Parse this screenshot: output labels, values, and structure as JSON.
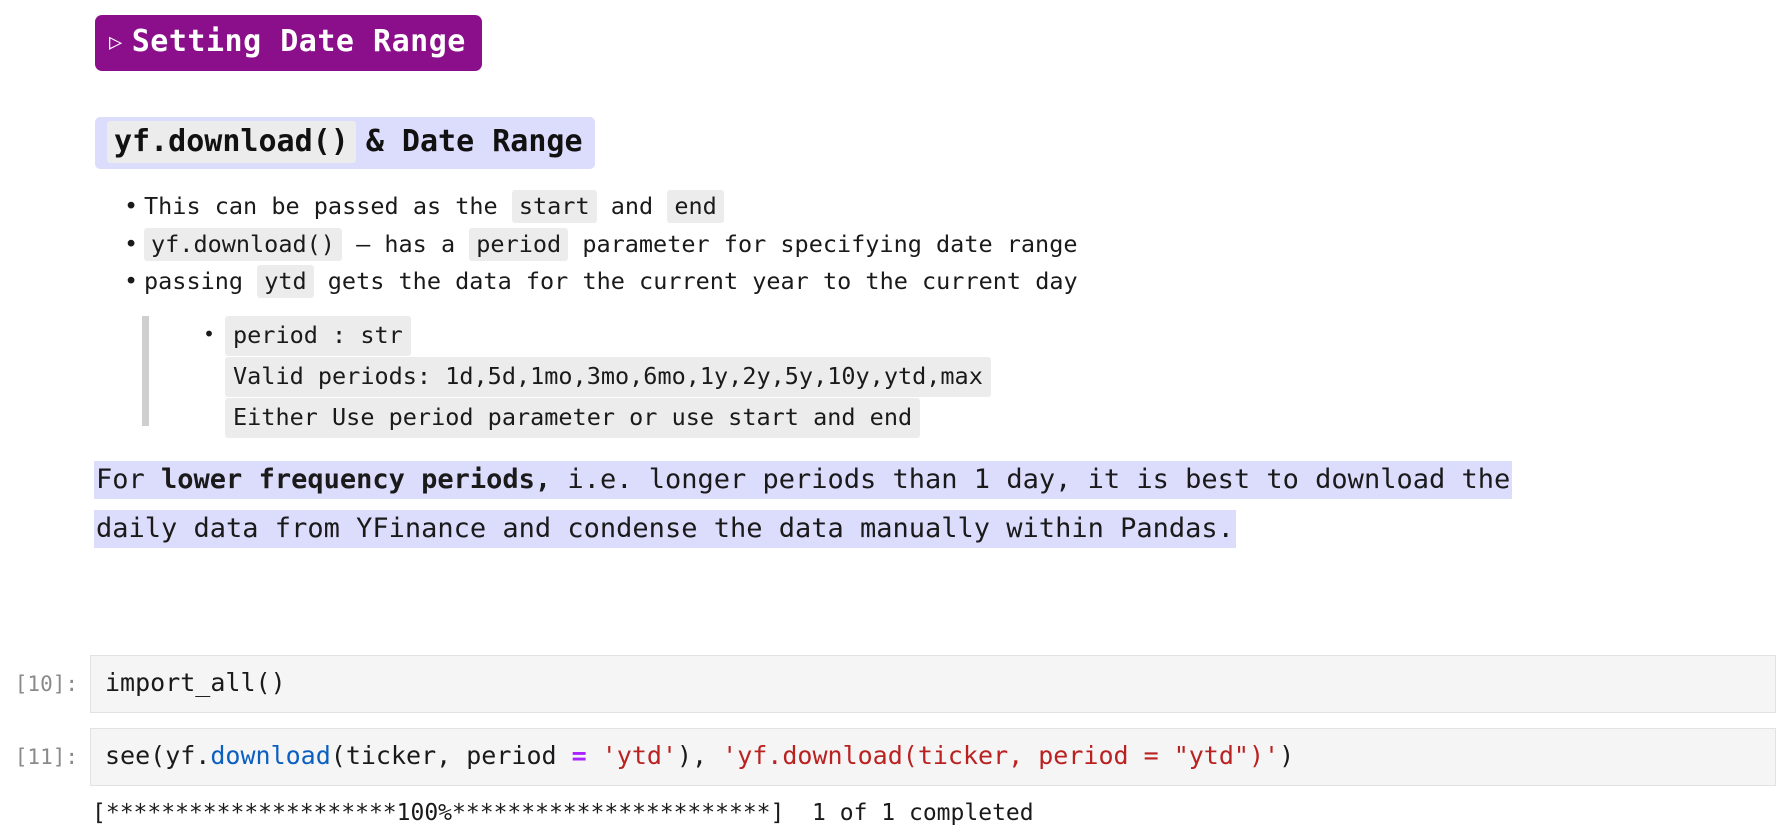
{
  "section": {
    "marker": "▷",
    "title": "Setting Date Range"
  },
  "subheading": {
    "code": "yf.download()",
    "rest": "& Date Range"
  },
  "bullets": [
    {
      "parts": [
        {
          "t": "text",
          "v": "This can be passed as the "
        },
        {
          "t": "code",
          "v": "start"
        },
        {
          "t": "text",
          "v": " and "
        },
        {
          "t": "code",
          "v": "end"
        }
      ]
    },
    {
      "parts": [
        {
          "t": "code",
          "v": "yf.download()"
        },
        {
          "t": "text",
          "v": " – has a "
        },
        {
          "t": "code",
          "v": "period"
        },
        {
          "t": "text",
          "v": " parameter for specifying date range"
        }
      ]
    },
    {
      "parts": [
        {
          "t": "text",
          "v": "passing "
        },
        {
          "t": "code",
          "v": "ytd"
        },
        {
          "t": "text",
          "v": " gets the data for the current year to the current day"
        }
      ]
    }
  ],
  "quote": {
    "item_title": "period : str",
    "line2": "Valid periods: 1d,5d,1mo,3mo,6mo,1y,2y,5y,10y,ytd,max",
    "line3": "Either Use period parameter or use start and end"
  },
  "highlight_paragraph": {
    "pre": "For ",
    "bold": "lower frequency periods,",
    "post": " i.e. longer periods than 1 day, it is best to download the daily data from YFinance and condense the data manually within Pandas."
  },
  "cells": [
    {
      "prompt": "[10]:",
      "code_plain": "import_all()",
      "tokens": [
        {
          "t": "plain",
          "v": "import_all()"
        }
      ]
    },
    {
      "prompt": "[11]:",
      "code_plain": "see(yf.download(ticker, period = 'ytd'), 'yf.download(ticker, period = \"ytd\")')",
      "tokens": [
        {
          "t": "plain",
          "v": "see(yf."
        },
        {
          "t": "fn",
          "v": "download"
        },
        {
          "t": "plain",
          "v": "(ticker, period "
        },
        {
          "t": "op",
          "v": "="
        },
        {
          "t": "plain",
          "v": " "
        },
        {
          "t": "str",
          "v": "'ytd'"
        },
        {
          "t": "plain",
          "v": "), "
        },
        {
          "t": "str",
          "v": "'yf.download(ticker, period = \"ytd\")'"
        },
        {
          "t": "plain",
          "v": ")"
        }
      ]
    }
  ],
  "output": {
    "text": "[*********************100%***********************]  1 of 1 completed"
  },
  "colors": {
    "section_badge_bg": "#8B0F8B",
    "highlight_bg": "#DCDCFC",
    "code_chip_bg": "#ECECEC",
    "cell_bg": "#F5F5F5",
    "prompt_fg": "#8A8A8A",
    "token_function": "#0B5FC1",
    "token_operator": "#AA22FF",
    "token_string": "#BA2121"
  }
}
